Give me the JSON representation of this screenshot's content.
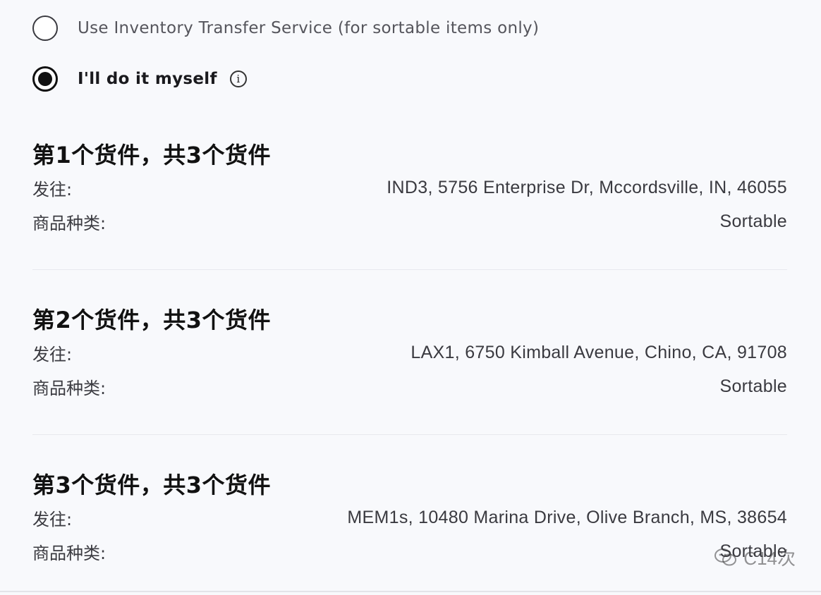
{
  "options": {
    "inventory_transfer": {
      "label": "Use Inventory Transfer Service (for sortable items only)",
      "selected": false
    },
    "do_it_myself": {
      "label": "I'll do it myself",
      "selected": true,
      "info_glyph": "i"
    }
  },
  "shipments": [
    {
      "title": "第1个货件，共3个货件",
      "ship_to_label": "发往:",
      "ship_to_value": "IND3, 5756 Enterprise Dr, Mccordsville, IN, 46055",
      "category_label": "商品种类:",
      "category_value": "Sortable"
    },
    {
      "title": "第2个货件，共3个货件",
      "ship_to_label": "发往:",
      "ship_to_value": "LAX1, 6750 Kimball Avenue, Chino, CA, 91708",
      "category_label": "商品种类:",
      "category_value": "Sortable"
    },
    {
      "title": "第3个货件，共3个货件",
      "ship_to_label": "发往:",
      "ship_to_value": "MEM1s, 10480 Marina Drive, Olive Branch, MS, 38654",
      "category_label": "商品种类:",
      "category_value": "Sortable"
    }
  ],
  "watermark": {
    "text": "C14次"
  },
  "icons": {
    "info": "info-icon",
    "watermark": "chat-bubble-icon"
  }
}
